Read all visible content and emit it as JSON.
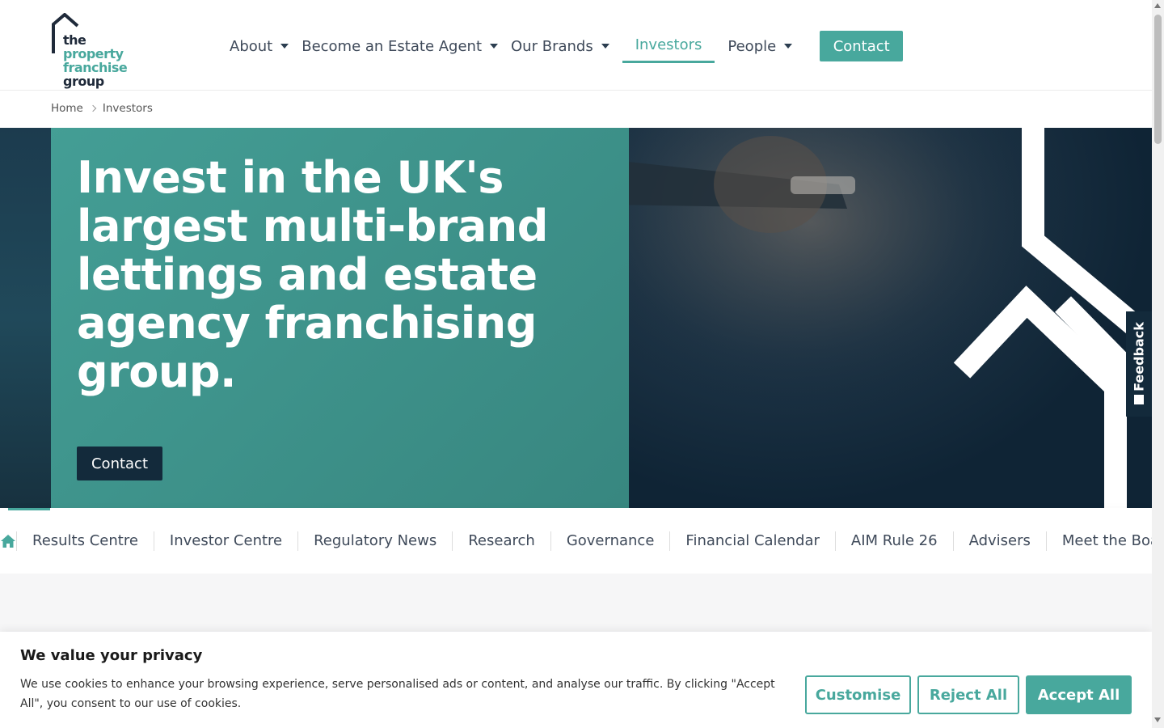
{
  "brand": {
    "logo_line1_a": "the",
    "logo_line1_b": "property",
    "logo_line2": "franchise",
    "logo_line3": "group",
    "accent_color": "#48a89d",
    "dark_color": "#132a3b"
  },
  "nav": {
    "items": [
      {
        "label": "About",
        "has_dropdown": true
      },
      {
        "label": "Become an Estate Agent",
        "has_dropdown": true
      },
      {
        "label": "Our Brands",
        "has_dropdown": true
      },
      {
        "label": "Investors",
        "has_dropdown": false,
        "active": true
      },
      {
        "label": "People",
        "has_dropdown": true
      }
    ],
    "contact_label": "Contact"
  },
  "breadcrumb": {
    "items": [
      "Home",
      "Investors"
    ]
  },
  "hero": {
    "title": "Invest in the UK's largest multi-brand lettings and estate agency franchising group.",
    "button_label": "Contact"
  },
  "feedback": {
    "label": "Feedback"
  },
  "subnav": {
    "home_icon": "home-icon",
    "items": [
      "Results Centre",
      "Investor Centre",
      "Regulatory News",
      "Research",
      "Governance",
      "Financial Calendar",
      "AIM Rule 26",
      "Advisers",
      "Meet the Board"
    ]
  },
  "cookie": {
    "title": "We value your privacy",
    "text": "We use cookies to enhance your browsing experience, serve personalised ads or content, and analyse our traffic. By clicking \"Accept All\", you consent to our use of cookies.",
    "customise_label": "Customise",
    "reject_label": "Reject All",
    "accept_label": "Accept All"
  }
}
